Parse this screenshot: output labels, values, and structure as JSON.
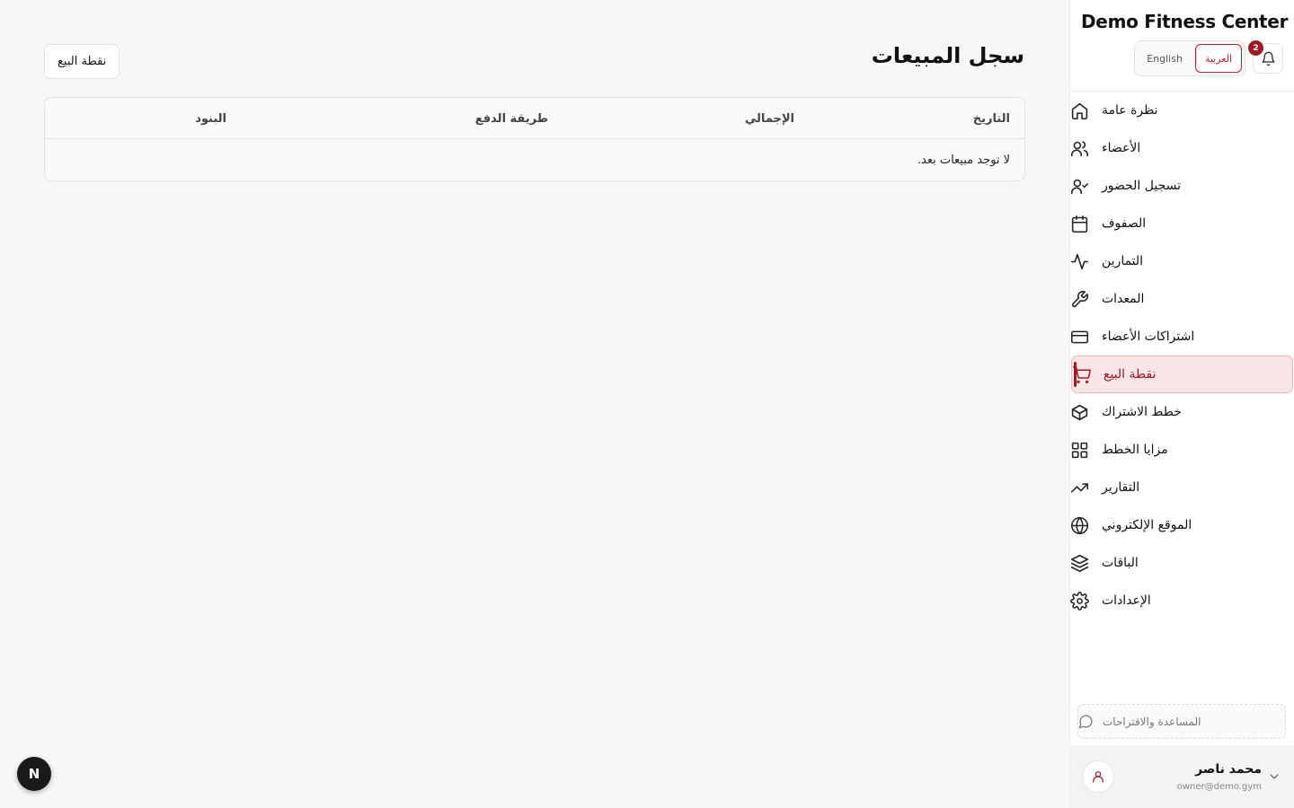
{
  "sidebar": {
    "brand": "Demo Fitness Center",
    "notifications_count": "2",
    "lang": {
      "en": "English",
      "ar": "العربية"
    },
    "items": [
      {
        "label": "نظرة عامة",
        "icon": "home-icon"
      },
      {
        "label": "الأعضاء",
        "icon": "users-icon"
      },
      {
        "label": "تسجيل الحضور",
        "icon": "user-check-icon"
      },
      {
        "label": "الصفوف",
        "icon": "calendar-icon"
      },
      {
        "label": "التمارين",
        "icon": "activity-icon"
      },
      {
        "label": "المعدات",
        "icon": "wrench-icon"
      },
      {
        "label": "اشتراكات الأعضاء",
        "icon": "credit-card-icon"
      },
      {
        "label": "نقطة البيع",
        "icon": "cart-icon",
        "active": true
      },
      {
        "label": "خطط الاشتراك",
        "icon": "package-icon"
      },
      {
        "label": "مزايا الخطط",
        "icon": "grid-icon"
      },
      {
        "label": "التقارير",
        "icon": "trending-up-icon"
      },
      {
        "label": "الموقع الإلكتروني",
        "icon": "globe-icon"
      },
      {
        "label": "الباقات",
        "icon": "layers-icon"
      },
      {
        "label": "الإعدادات",
        "icon": "settings-icon"
      }
    ],
    "help": "المساعدة والاقتراحات",
    "user": {
      "name": "محمد ناصر",
      "email": "owner@demo.gym"
    }
  },
  "main": {
    "title": "سجل المبيعات",
    "pos_button": "نقطة البيع",
    "table": {
      "headers": [
        "التاريخ",
        "الإجمالي",
        "طريقة الدفع",
        "البنود"
      ],
      "empty": "لا توجد مبيعات بعد."
    }
  },
  "dev_badge": "N",
  "colors": {
    "accent": "#9b1c24",
    "active_bg": "#f8e6e7"
  }
}
